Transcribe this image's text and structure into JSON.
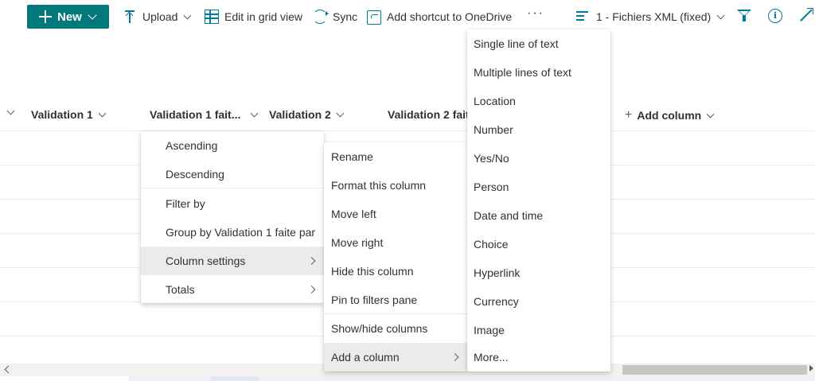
{
  "toolbar": {
    "new_label": "New",
    "upload_label": "Upload",
    "grid_label": "Edit in grid view",
    "sync_label": "Sync",
    "shortcut_label": "Add shortcut to OneDrive",
    "more_label": "···",
    "view_label": "1 - Fichiers XML (fixed)",
    "info_label": "i"
  },
  "columns": {
    "col1": "Validation 1",
    "col2": "Validation 1 fait...",
    "col3": "Validation 2",
    "col4": "Validation 2 fait",
    "add_column": "Add column"
  },
  "column_menu": {
    "ascending": "Ascending",
    "descending": "Descending",
    "filter_by": "Filter by",
    "group_by": "Group by Validation 1 faite par",
    "column_settings": "Column settings",
    "totals": "Totals"
  },
  "settings_menu": {
    "rename": "Rename",
    "format": "Format this column",
    "move_left": "Move left",
    "move_right": "Move right",
    "hide": "Hide this column",
    "pin": "Pin to filters pane",
    "show_hide": "Show/hide columns",
    "add_column": "Add a column"
  },
  "column_types": [
    "Single line of text",
    "Multiple lines of text",
    "Location",
    "Number",
    "Yes/No",
    "Person",
    "Date and time",
    "Choice",
    "Hyperlink",
    "Currency",
    "Image",
    "More..."
  ],
  "colors": {
    "accent": "#03787c",
    "icon_blue": "#0078a0",
    "hover": "#edebe9"
  }
}
